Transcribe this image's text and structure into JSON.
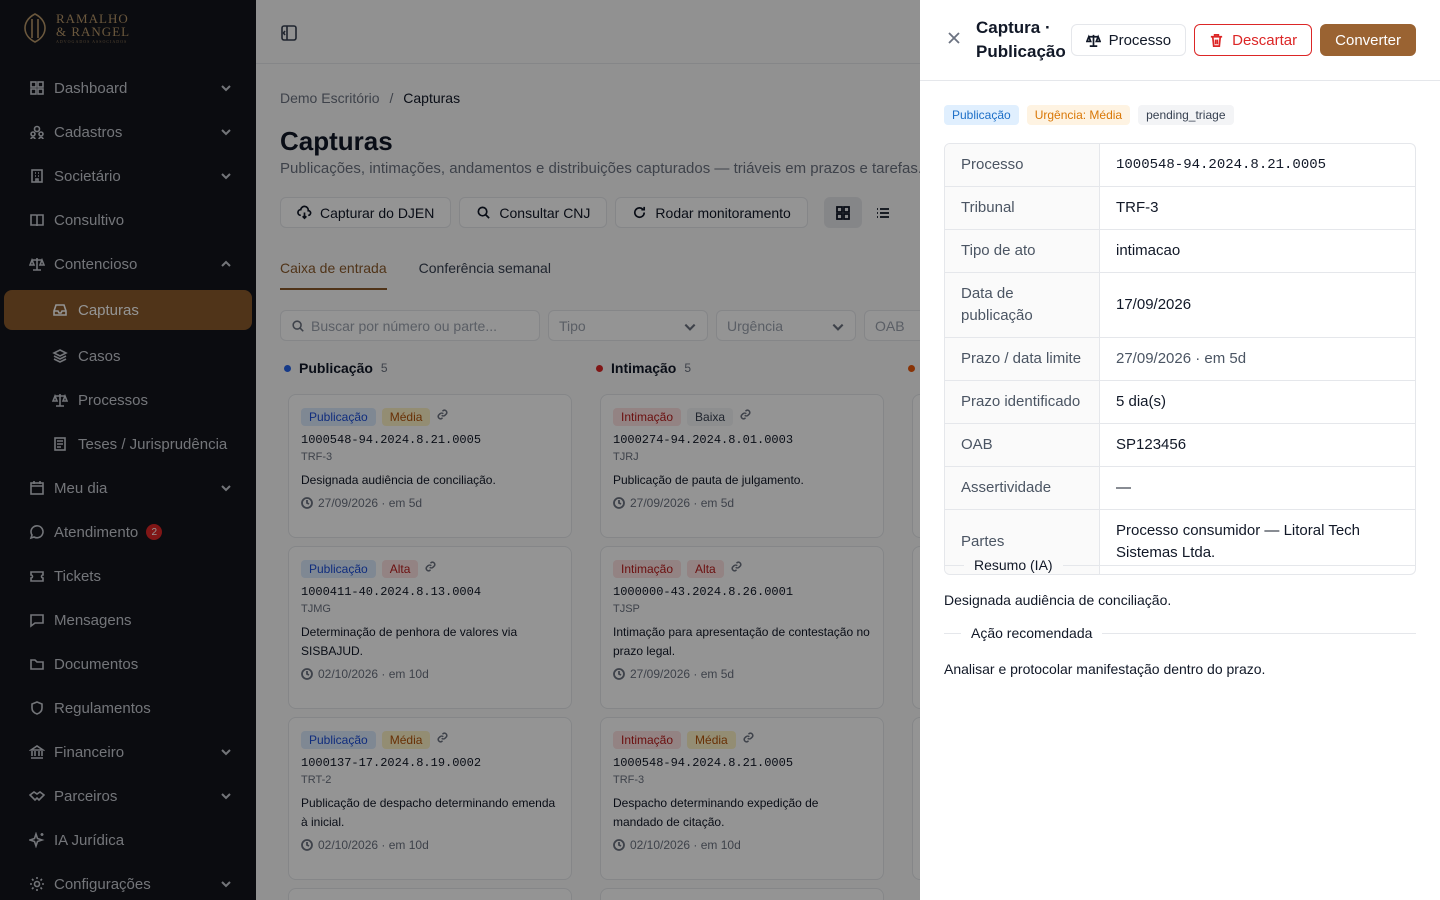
{
  "brand": {
    "line1": "RAMALHO",
    "line2": "& RANGEL",
    "line3": "ADVOGADOS ASSOCIADOS"
  },
  "sidebar": {
    "items": [
      {
        "label": "Dashboard",
        "icon": "grid-icon",
        "chevron": true
      },
      {
        "label": "Cadastros",
        "icon": "users-icon",
        "chevron": true
      },
      {
        "label": "Societário",
        "icon": "building-icon",
        "chevron": true
      },
      {
        "label": "Consultivo",
        "icon": "book-icon",
        "chevron": false
      },
      {
        "label": "Contencioso",
        "icon": "scale-icon",
        "chevron": true,
        "expanded": true
      }
    ],
    "sub_items": [
      {
        "label": "Capturas",
        "icon": "inbox-icon",
        "active": true
      },
      {
        "label": "Casos",
        "icon": "layers-icon"
      },
      {
        "label": "Processos",
        "icon": "scale-icon"
      },
      {
        "label": "Teses / Jurisprudência",
        "icon": "library-icon"
      }
    ],
    "items2": [
      {
        "label": "Meu dia",
        "icon": "calendar-icon",
        "chevron": true
      },
      {
        "label": "Atendimento",
        "icon": "chat-icon",
        "badge": "2"
      },
      {
        "label": "Tickets",
        "icon": "ticket-icon"
      },
      {
        "label": "Mensagens",
        "icon": "message-icon"
      },
      {
        "label": "Documentos",
        "icon": "folder-icon"
      },
      {
        "label": "Regulamentos",
        "icon": "shield-icon"
      },
      {
        "label": "Financeiro",
        "icon": "bank-icon",
        "chevron": true
      },
      {
        "label": "Parceiros",
        "icon": "handshake-icon",
        "chevron": true
      },
      {
        "label": "IA Jurídica",
        "icon": "sparkle-icon"
      },
      {
        "label": "Configurações",
        "icon": "gear-icon",
        "chevron": true
      }
    ]
  },
  "main": {
    "breadcrumb": {
      "root": "Demo Escritório",
      "sep": "/",
      "current": "Capturas"
    },
    "title": "Capturas",
    "subtitle": "Publicações, intimações, andamentos e distribuições capturados — triáveis em prazos e tarefas.",
    "actions": [
      "Capturar do DJEN",
      "Consultar CNJ",
      "Rodar monitoramento"
    ],
    "tabs": [
      "Caixa de entrada",
      "Conferência semanal"
    ],
    "filters": {
      "search_placeholder": "Buscar por número ou parte...",
      "tipo": "Tipo",
      "urgencia": "Urgência",
      "oab": "OAB"
    },
    "columns": [
      {
        "title": "Publicação",
        "count": "5",
        "color": "#2563eb",
        "cards": [
          {
            "type": "Publicação",
            "urgency": "Média",
            "number": "1000548-94.2024.8.21.0005",
            "court": "TRF-3",
            "text": "Designada audiência de conciliação.",
            "date": "27/09/2026 · em 5d"
          },
          {
            "type": "Publicação",
            "urgency": "Alta",
            "number": "1000411-40.2024.8.13.0004",
            "court": "TJMG",
            "text": "Determinação de penhora de valores via SISBAJUD.",
            "date": "02/10/2026 · em 10d"
          },
          {
            "type": "Publicação",
            "urgency": "Média",
            "number": "1000137-17.2024.8.19.0002",
            "court": "TRT-2",
            "text": "Publicação de despacho determinando emenda à inicial.",
            "date": "02/10/2026 · em 10d"
          }
        ]
      },
      {
        "title": "Intimação",
        "count": "5",
        "color": "#dc2626",
        "cards": [
          {
            "type": "Intimação",
            "urgency": "Baixa",
            "number": "1000274-94.2024.8.01.0003",
            "court": "TJRJ",
            "text": "Publicação de pauta de julgamento.",
            "date": "27/09/2026 · em 5d"
          },
          {
            "type": "Intimação",
            "urgency": "Alta",
            "number": "1000000-43.2024.8.26.0001",
            "court": "TJSP",
            "text": "Intimação para apresentação de contestação no prazo legal.",
            "date": "27/09/2026 · em 5d"
          },
          {
            "type": "Intimação",
            "urgency": "Média",
            "number": "1000548-94.2024.8.21.0005",
            "court": "TRF-3",
            "text": "Despacho determinando expedição de mandado de citação.",
            "date": "02/10/2026 · em 10d"
          }
        ]
      }
    ]
  },
  "drawer": {
    "title": "Captura · Publicação",
    "buttons": {
      "processo": "Processo",
      "descartar": "Descartar",
      "converter": "Converter"
    },
    "tags": {
      "type": "Publicação",
      "urgency": "Urgência: Média",
      "status": "pending_triage"
    },
    "rows": [
      {
        "k": "Processo",
        "v": "1000548-94.2024.8.21.0005",
        "mono": true
      },
      {
        "k": "Tribunal",
        "v": "TRF-3"
      },
      {
        "k": "Tipo de ato",
        "v": "intimacao"
      },
      {
        "k": "Data de publicação",
        "v": "17/09/2026"
      },
      {
        "k": "Prazo / data limite",
        "v": "27/09/2026 · em 5d",
        "muted": true
      },
      {
        "k": "Prazo identificado",
        "v": "5 dia(s)"
      },
      {
        "k": "OAB",
        "v": "SP123456"
      },
      {
        "k": "Assertividade",
        "v": "—"
      },
      {
        "k": "Partes",
        "v": "Processo consumidor — Litoral Tech Sistemas Ltda."
      }
    ],
    "summary_title": "Resumo (IA)",
    "summary": "Designada audiência de conciliação.",
    "action_title": "Ação recomendada",
    "action": "Analisar e protocolar manifestação dentro do prazo."
  }
}
